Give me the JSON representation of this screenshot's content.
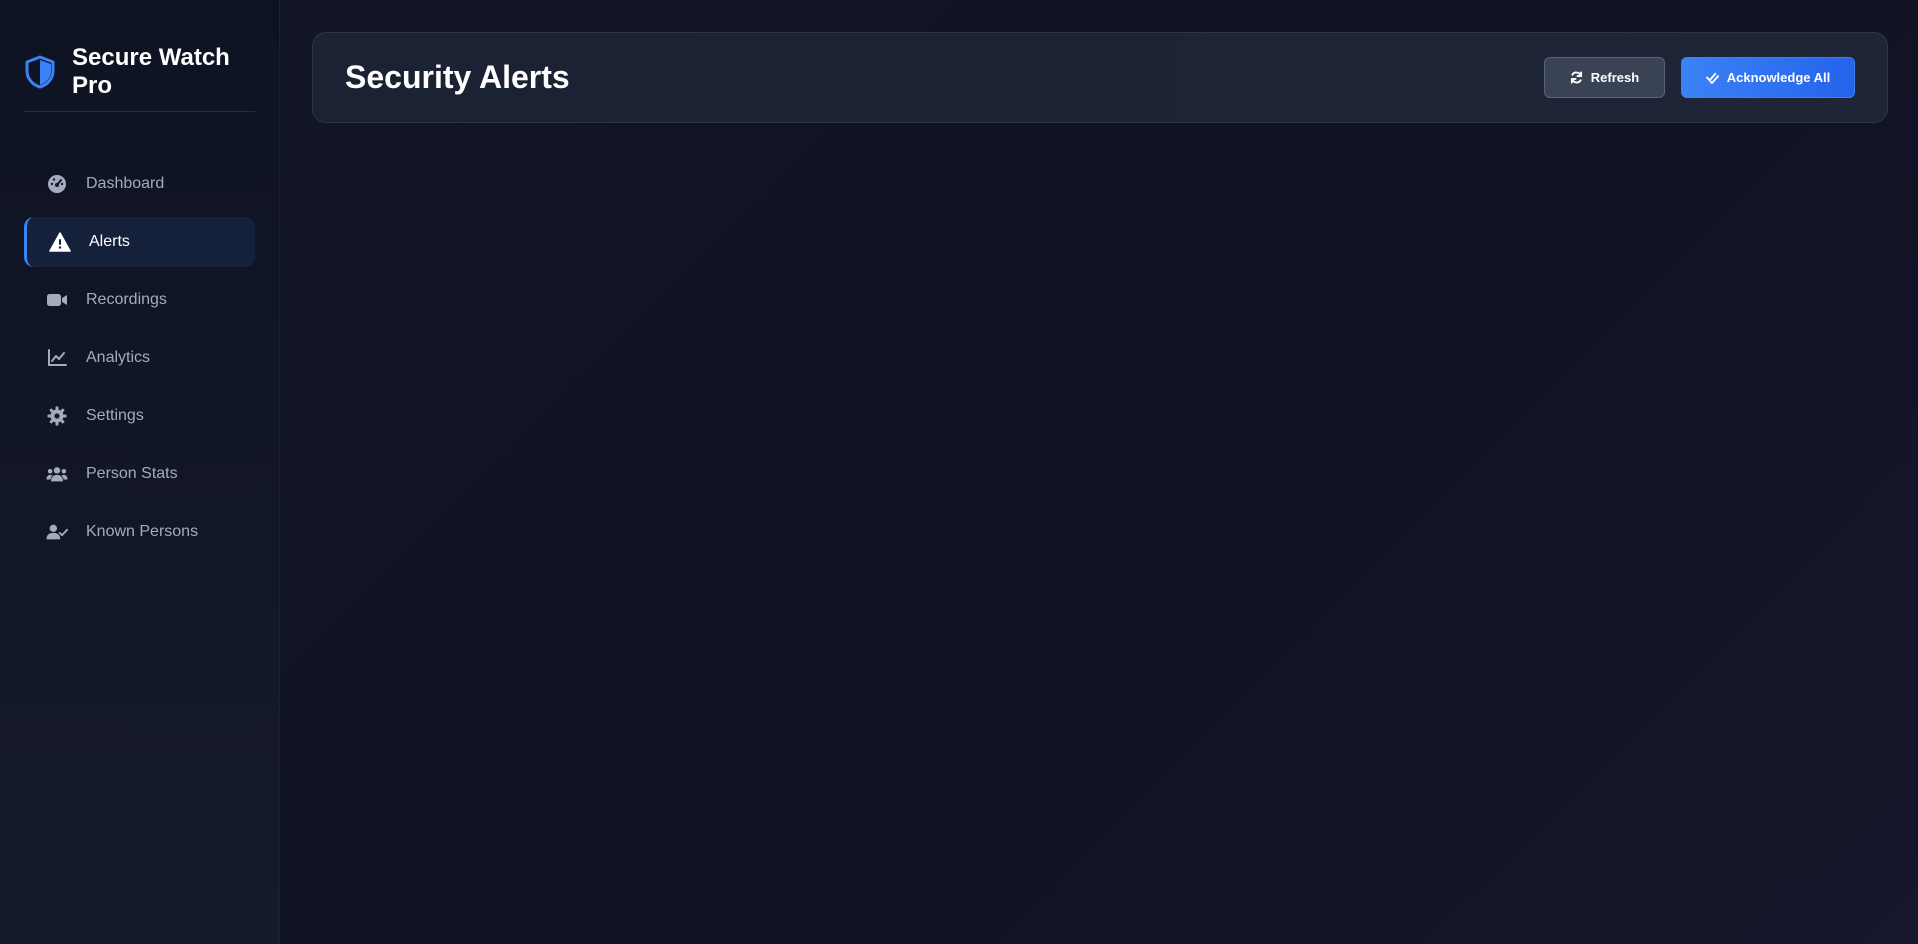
{
  "app": {
    "name": "Secure Watch Pro",
    "brand_icon": "shield-icon",
    "accent_color": "#3b82f6"
  },
  "sidebar": {
    "items": [
      {
        "label": "Dashboard",
        "icon": "dashboard-gauge-icon",
        "active": false
      },
      {
        "label": "Alerts",
        "icon": "warning-triangle-icon",
        "active": true
      },
      {
        "label": "Recordings",
        "icon": "video-camera-icon",
        "active": false
      },
      {
        "label": "Analytics",
        "icon": "line-chart-icon",
        "active": false
      },
      {
        "label": "Settings",
        "icon": "gear-icon",
        "active": false
      },
      {
        "label": "Person Stats",
        "icon": "users-icon",
        "active": false
      },
      {
        "label": "Known Persons",
        "icon": "user-check-icon",
        "active": false
      }
    ]
  },
  "header": {
    "title": "Security Alerts",
    "refresh_label": "Refresh",
    "refresh_icon": "refresh-icon",
    "acknowledge_label": "Acknowledge All",
    "acknowledge_icon": "double-check-icon"
  }
}
